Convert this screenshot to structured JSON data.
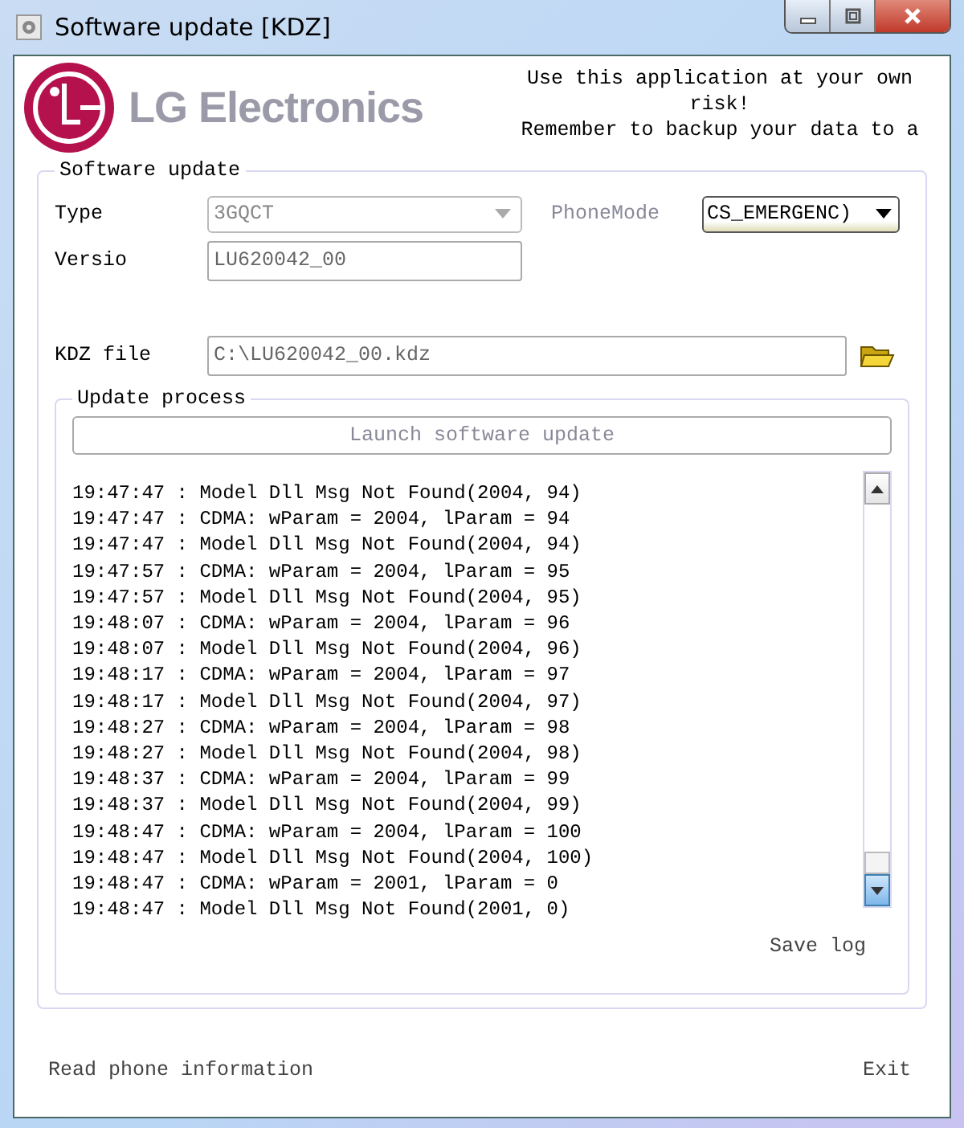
{
  "window": {
    "title": "Software update [KDZ]"
  },
  "logo": {
    "text": "LG Electronics"
  },
  "notice": "Use this application at your own risk!\nRemember to backup your data to a",
  "software_update": {
    "title": "Software update",
    "type": {
      "label": "Type",
      "value": "3GQCT",
      "disabled": true
    },
    "phone_mode": {
      "label": "PhoneMode",
      "value": "CS_EMERGENC)"
    },
    "version": {
      "label": "Versio",
      "value": "LU620042_00"
    },
    "kdz_file": {
      "label": "KDZ file",
      "value": "C:\\LU620042_00.kdz"
    },
    "update_process": {
      "title": "Update process",
      "launch_button": {
        "label": "Launch software update",
        "disabled": true
      },
      "log": [
        "19:47:47 : Model Dll Msg Not Found(2004, 94)",
        "19:47:47 : CDMA: wParam = 2004, lParam = 94",
        "19:47:47 : Model Dll Msg Not Found(2004, 94)",
        "19:47:57 : CDMA: wParam = 2004, lParam = 95",
        "19:47:57 : Model Dll Msg Not Found(2004, 95)",
        "19:48:07 : CDMA: wParam = 2004, lParam = 96",
        "19:48:07 : Model Dll Msg Not Found(2004, 96)",
        "19:48:17 : CDMA: wParam = 2004, lParam = 97",
        "19:48:17 : Model Dll Msg Not Found(2004, 97)",
        "19:48:27 : CDMA: wParam = 2004, lParam = 98",
        "19:48:27 : Model Dll Msg Not Found(2004, 98)",
        "19:48:37 : CDMA: wParam = 2004, lParam = 99",
        "19:48:37 : Model Dll Msg Not Found(2004, 99)",
        "19:48:47 : CDMA: wParam = 2004, lParam = 100",
        "19:48:47 : Model Dll Msg Not Found(2004, 100)",
        "19:48:47 : CDMA: wParam = 2001, lParam = 0",
        "19:48:47 : Model Dll Msg Not Found(2001, 0)"
      ],
      "save_log": "Save log"
    }
  },
  "buttons": {
    "read_phone_information": "Read phone information",
    "exit": "Exit"
  }
}
